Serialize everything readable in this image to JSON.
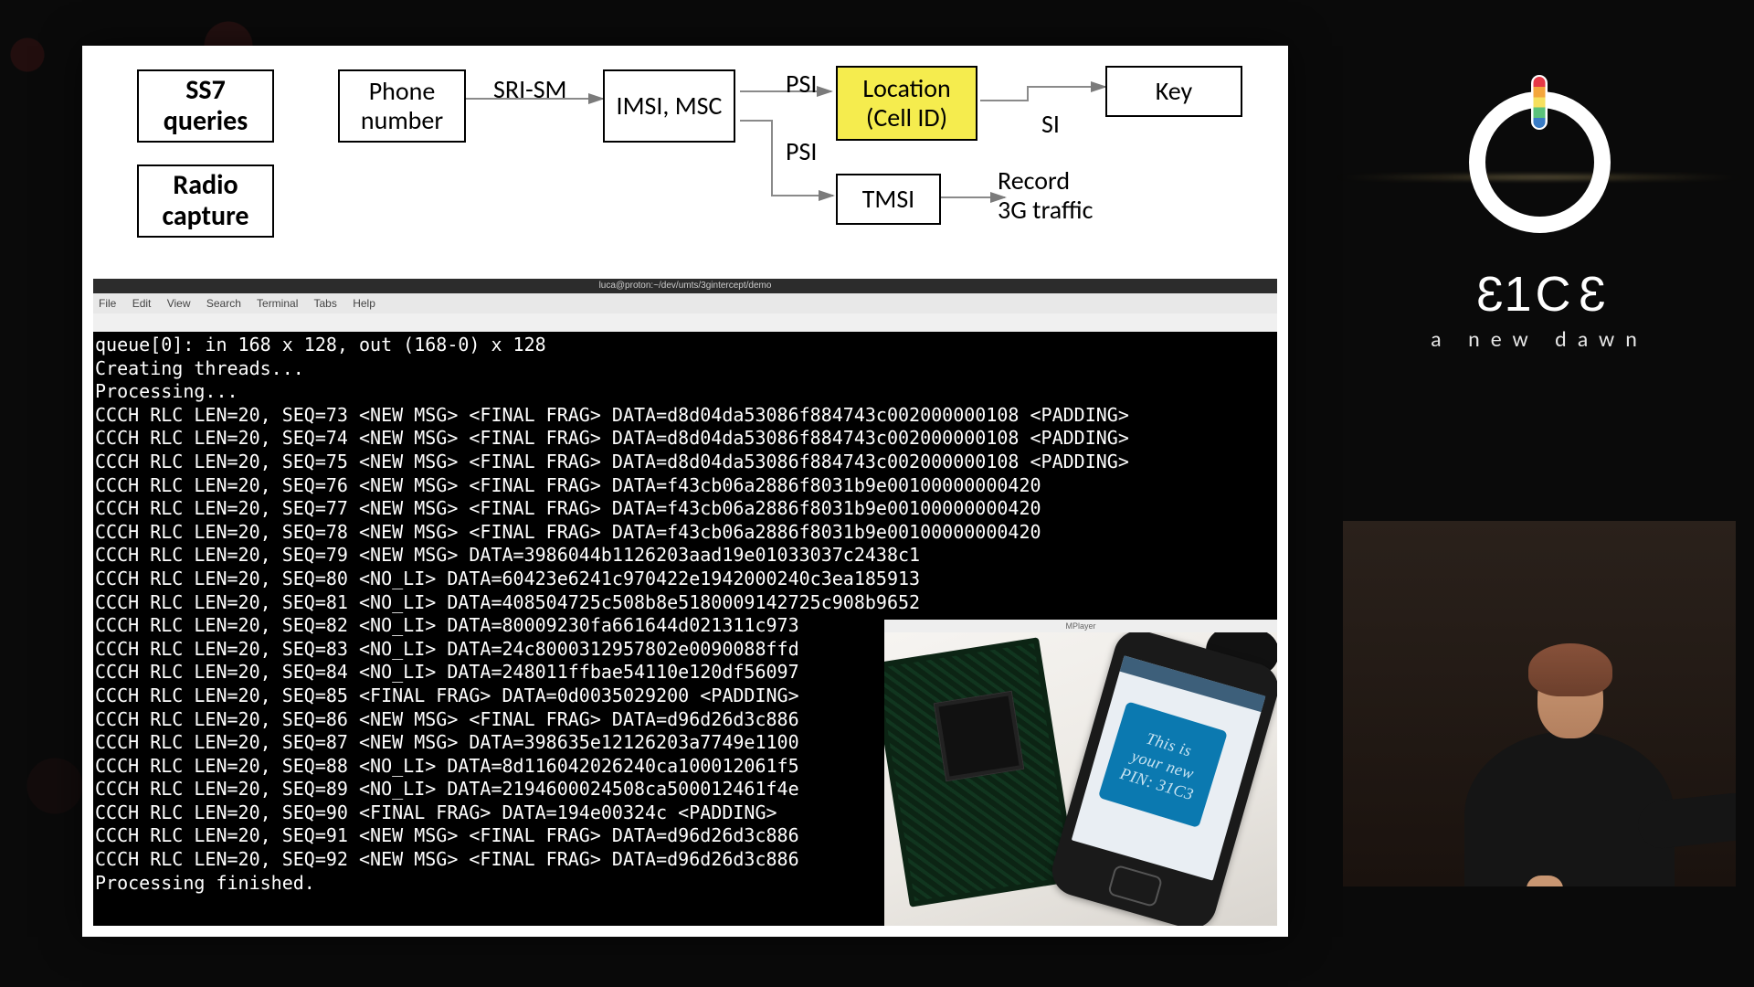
{
  "diagram": {
    "boxes": {
      "ss7": "SS7\nqueries",
      "radio": "Radio\ncapture",
      "phone": "Phone\nnumber",
      "imsi": "IMSI,\nMSC",
      "location": "Location\n(Cell ID)",
      "tmsi": "TMSI",
      "key": "Key"
    },
    "labels": {
      "srism": "SRI-SM",
      "psi1": "PSI",
      "psi2": "PSI",
      "si": "SI",
      "record": "Record\n3G traffic"
    }
  },
  "terminal": {
    "title": "luca@proton:~/dev/umts/3gintercept/demo",
    "menu": [
      "File",
      "Edit",
      "View",
      "Search",
      "Terminal",
      "Tabs",
      "Help"
    ],
    "lines": [
      "queue[0]: in 168 x 128, out (168-0) x 128",
      "Creating threads...",
      "Processing...",
      "CCCH RLC LEN=20, SEQ=73 <NEW MSG> <FINAL FRAG> DATA=d8d04da53086f884743c002000000108 <PADDING>",
      "CCCH RLC LEN=20, SEQ=74 <NEW MSG> <FINAL FRAG> DATA=d8d04da53086f884743c002000000108 <PADDING>",
      "CCCH RLC LEN=20, SEQ=75 <NEW MSG> <FINAL FRAG> DATA=d8d04da53086f884743c002000000108 <PADDING>",
      "CCCH RLC LEN=20, SEQ=76 <NEW MSG> <FINAL FRAG> DATA=f43cb06a2886f8031b9e00100000000420",
      "CCCH RLC LEN=20, SEQ=77 <NEW MSG> <FINAL FRAG> DATA=f43cb06a2886f8031b9e00100000000420",
      "CCCH RLC LEN=20, SEQ=78 <NEW MSG> <FINAL FRAG> DATA=f43cb06a2886f8031b9e00100000000420",
      "CCCH RLC LEN=20, SEQ=79 <NEW MSG> DATA=3986044b1126203aad19e01033037c2438c1",
      "CCCH RLC LEN=20, SEQ=80 <NO_LI> DATA=60423e6241c970422e1942000240c3ea185913",
      "CCCH RLC LEN=20, SEQ=81 <NO_LI> DATA=408504725c508b8e5180009142725c908b9652",
      "CCCH RLC LEN=20, SEQ=82 <NO_LI> DATA=80009230fa661644d021311c973",
      "CCCH RLC LEN=20, SEQ=83 <NO_LI> DATA=24c8000312957802e0090088ffd",
      "CCCH RLC LEN=20, SEQ=84 <NO_LI> DATA=248011ffbae54110e120df56097",
      "CCCH RLC LEN=20, SEQ=85 <FINAL FRAG> DATA=0d0035029200 <PADDING>",
      "CCCH RLC LEN=20, SEQ=86 <NEW MSG> <FINAL FRAG> DATA=d96d26d3c886",
      "CCCH RLC LEN=20, SEQ=87 <NEW MSG> DATA=398635e12126203a7749e1100",
      "CCCH RLC LEN=20, SEQ=88 <NO_LI> DATA=8d116042026240ca100012061f5",
      "CCCH RLC LEN=20, SEQ=89 <NO_LI> DATA=2194600024508ca500012461f4e",
      "CCCH RLC LEN=20, SEQ=90 <FINAL FRAG> DATA=194e00324c <PADDING>",
      "CCCH RLC LEN=20, SEQ=91 <NEW MSG> <FINAL FRAG> DATA=d96d26d3c886",
      "CCCH RLC LEN=20, SEQ=92 <NEW MSG> <FINAL FRAG> DATA=d96d26d3c886",
      "Processing finished."
    ]
  },
  "photo": {
    "window_title": "MPlayer",
    "sms_text": "This is\nyour new\nPIN: 31C3"
  },
  "branding": {
    "name": "31C3",
    "tagline": "a new dawn"
  }
}
